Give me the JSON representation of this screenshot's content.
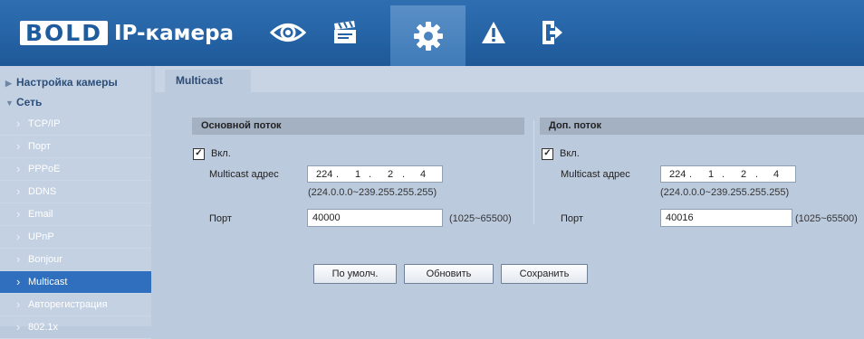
{
  "header": {
    "logo_text": "BOLD",
    "title": "IP-камера",
    "nav": [
      "eye-icon",
      "clapperboard-icon",
      "gear-icon",
      "warning-icon",
      "logout-icon"
    ]
  },
  "sidebar": {
    "group_camera": "Настройка камеры",
    "group_network": "Сеть",
    "items": [
      "TCP/IP",
      "Порт",
      "PPPoE",
      "DDNS",
      "Email",
      "UPnP",
      "Bonjour",
      "Multicast",
      "Авторегистрация",
      "802.1x"
    ]
  },
  "tab": "Multicast",
  "main_stream": {
    "title": "Основной поток",
    "enable_label": "Вкл.",
    "enabled": true,
    "address_label": "Multicast адрес",
    "ip": [
      "224",
      "1",
      "2",
      "4"
    ],
    "ip_range": "(224.0.0.0~239.255.255.255)",
    "port_label": "Порт",
    "port": "40000",
    "port_range": "(1025~65500)"
  },
  "sub_stream": {
    "title": "Доп. поток",
    "enable_label": "Вкл.",
    "enabled": true,
    "address_label": "Multicast адрес",
    "ip": [
      "224",
      "1",
      "2",
      "4"
    ],
    "ip_range": "(224.0.0.0~239.255.255.255)",
    "port_label": "Порт",
    "port": "40016",
    "port_range": "(1025~65500)"
  },
  "buttons": {
    "default": "По умолч.",
    "refresh": "Обновить",
    "save": "Сохранить"
  },
  "colors": {
    "header": "#2462a4",
    "active_item": "#2f6fbd",
    "background": "#bccadd"
  }
}
